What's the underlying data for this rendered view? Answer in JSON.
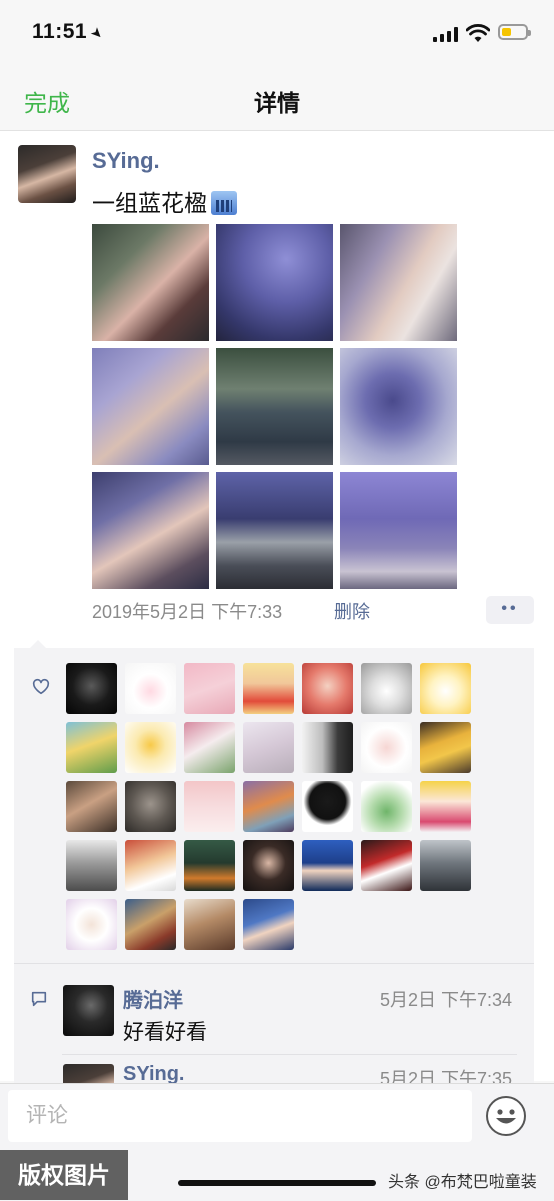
{
  "status_bar": {
    "time": "11:51"
  },
  "nav": {
    "done": "完成",
    "title": "详情"
  },
  "post": {
    "author": "SYing.",
    "text": "一组蓝花楹",
    "emoji_icon": "cityscape-emoji",
    "time": "2019年5月2日 下午7:33",
    "delete": "删除",
    "more": "••",
    "photos": [
      "photo-1",
      "photo-2",
      "photo-3",
      "photo-4",
      "photo-5",
      "photo-6",
      "photo-7",
      "photo-8",
      "photo-9"
    ]
  },
  "likes": {
    "icon": "heart-icon",
    "count_visible": 32
  },
  "comments": [
    {
      "name": "腾泊洋",
      "time": "5月2日 下午7:34",
      "text": "好看好看"
    },
    {
      "name": "SYing.",
      "time": "5月2日 下午7:35",
      "text": ""
    }
  ],
  "input": {
    "placeholder": "评论"
  },
  "watermark": {
    "copyright": "版权图片",
    "source": "头条 @布梵巴啦童装"
  },
  "colors": {
    "accent_green": "#3fb64a",
    "link_blue": "#576b95",
    "battery_yellow": "#f5c400"
  }
}
